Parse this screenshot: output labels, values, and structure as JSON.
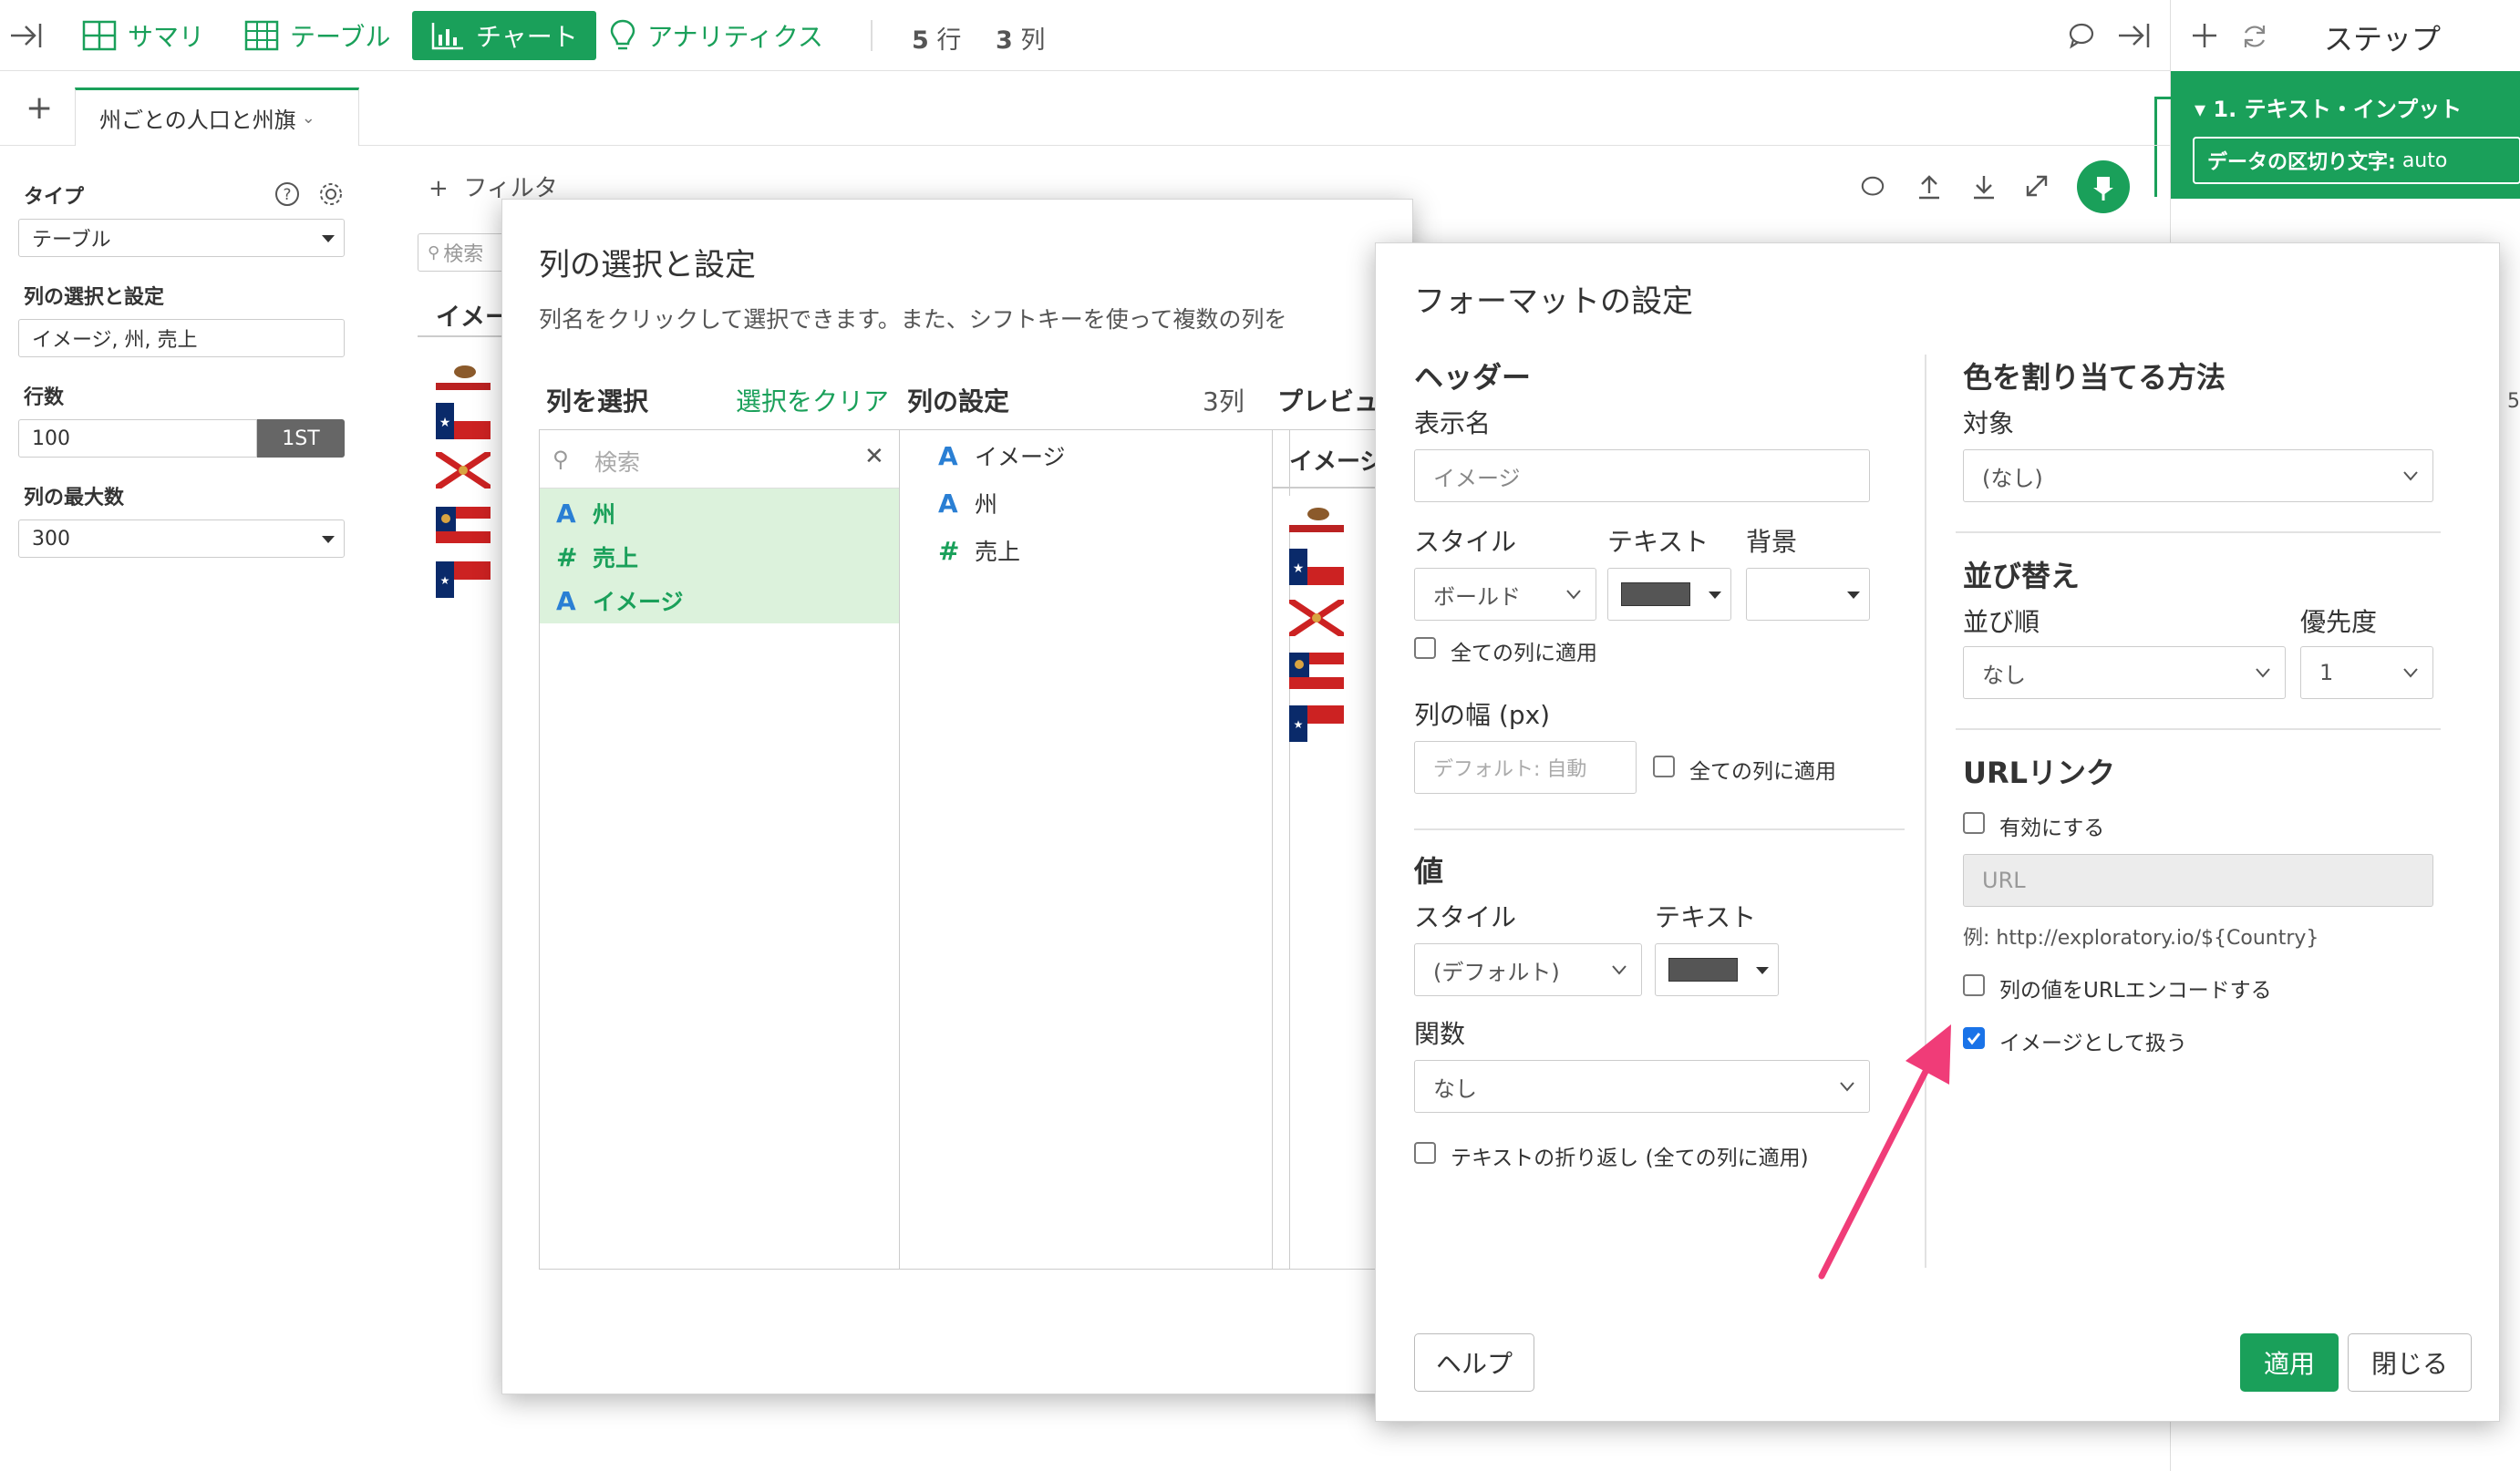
{
  "toolbar": {
    "summary_label": "サマリ",
    "table_label": "テーブル",
    "chart_label": "チャート",
    "analytics_label": "アナリティクス",
    "rows_count": "5",
    "rows_unit": "行",
    "cols_count": "3",
    "cols_unit": "列"
  },
  "steps": {
    "title": "ステップ",
    "step1_label": "1. テキスト・インプット",
    "delimiter_label": "データの区切り文字:",
    "delimiter_value": "auto"
  },
  "tabs": {
    "add": "+",
    "current": "州ごとの人口と州旗"
  },
  "left_panel": {
    "type_label": "タイプ",
    "type_value": "テーブル",
    "cols_label": "列の選択と設定",
    "cols_value": "イメージ, 州, 売上",
    "rows_label": "行数",
    "rows_value": "100",
    "rows_btn": "1ST",
    "maxcols_label": "列の最大数",
    "maxcols_value": "300"
  },
  "chart_area": {
    "filter": "フィルタ",
    "search": "検索",
    "col_header": "イメー"
  },
  "column_dialog": {
    "title": "列の選択と設定",
    "description": "列名をクリックして選択できます。また、シフトキーを使って複数の列を",
    "select_header": "列を選択",
    "clear_link": "選択をクリア",
    "search_placeholder": "検索",
    "available": [
      {
        "icon": "A",
        "name": "州"
      },
      {
        "icon": "#",
        "name": "売上"
      },
      {
        "icon": "A",
        "name": "イメージ"
      }
    ],
    "settings_header": "列の設定",
    "settings_count": "3列",
    "settings": [
      {
        "icon": "A",
        "name": "イメージ"
      },
      {
        "icon": "A",
        "name": "州"
      },
      {
        "icon": "#",
        "name": "売上"
      }
    ],
    "preview_header": "プレビュ",
    "preview_col": "イメージ"
  },
  "format_dialog": {
    "title": "フォーマットの設定",
    "header_section": "ヘッダー",
    "display_name_label": "表示名",
    "display_name_placeholder": "イメージ",
    "style_label": "スタイル",
    "text_label": "テキスト",
    "bg_label": "背景",
    "style_value": "ボールド",
    "apply_all": "全ての列に適用",
    "width_label": "列の幅 (px)",
    "width_placeholder": "デフォルト: 自動",
    "width_apply_all": "全ての列に適用",
    "value_section": "値",
    "value_style_label": "スタイル",
    "value_text_label": "テキスト",
    "value_style_value": "(デフォルト)",
    "func_label": "関数",
    "func_value": "なし",
    "wrap_label": "テキストの折り返し (全ての列に適用)",
    "color_section": "色を割り当てる方法",
    "target_label": "対象",
    "target_value": "(なし)",
    "sort_section": "並び替え",
    "order_label": "並び順",
    "priority_label": "優先度",
    "order_value": "なし",
    "priority_value": "1",
    "url_section": "URLリンク",
    "enable_label": "有効にする",
    "url_placeholder": "URL",
    "url_example": "例: http://exploratory.io/${Country}",
    "encode_label": "列の値をURLエンコードする",
    "image_label": "イメージとして扱う",
    "help_btn": "ヘルプ",
    "apply_btn": "適用",
    "close_btn": "閉じる"
  },
  "colors": {
    "accent": "#1aa05a",
    "selected_row_bg": "#dcf2dc",
    "arrow": "#f03c78",
    "checkbox_checked": "#1a73e8",
    "text_color_swatch": "#555555"
  }
}
